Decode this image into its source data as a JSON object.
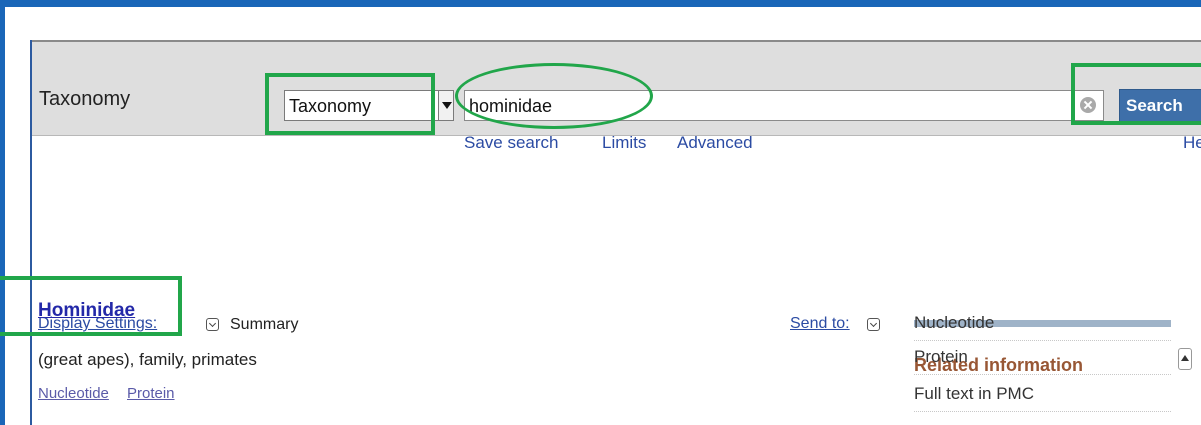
{
  "header": {
    "db_title": "Taxonomy",
    "db_select_value": "Taxonomy",
    "search_value": "hominidae",
    "search_button": "Search",
    "links": {
      "save_search": "Save search",
      "limits": "Limits",
      "advanced": "Advanced",
      "help": "Help"
    }
  },
  "toolbar": {
    "display_settings": "Display Settings:",
    "summary": "Summary",
    "send_to": "Send to:"
  },
  "result": {
    "title": "Hominidae",
    "description": "(great apes), family, primates",
    "links": [
      "Nucleotide",
      "Protein"
    ]
  },
  "sidebar": {
    "heading": "Related information",
    "items": [
      "Nucleotide",
      "Protein",
      "Full text in PMC"
    ]
  },
  "colors": {
    "frame": "#1a66b8",
    "highlight": "#21a64a",
    "search_button": "#3e6fa9",
    "link": "#2b4ba3",
    "sidebar_heading": "#985735"
  }
}
